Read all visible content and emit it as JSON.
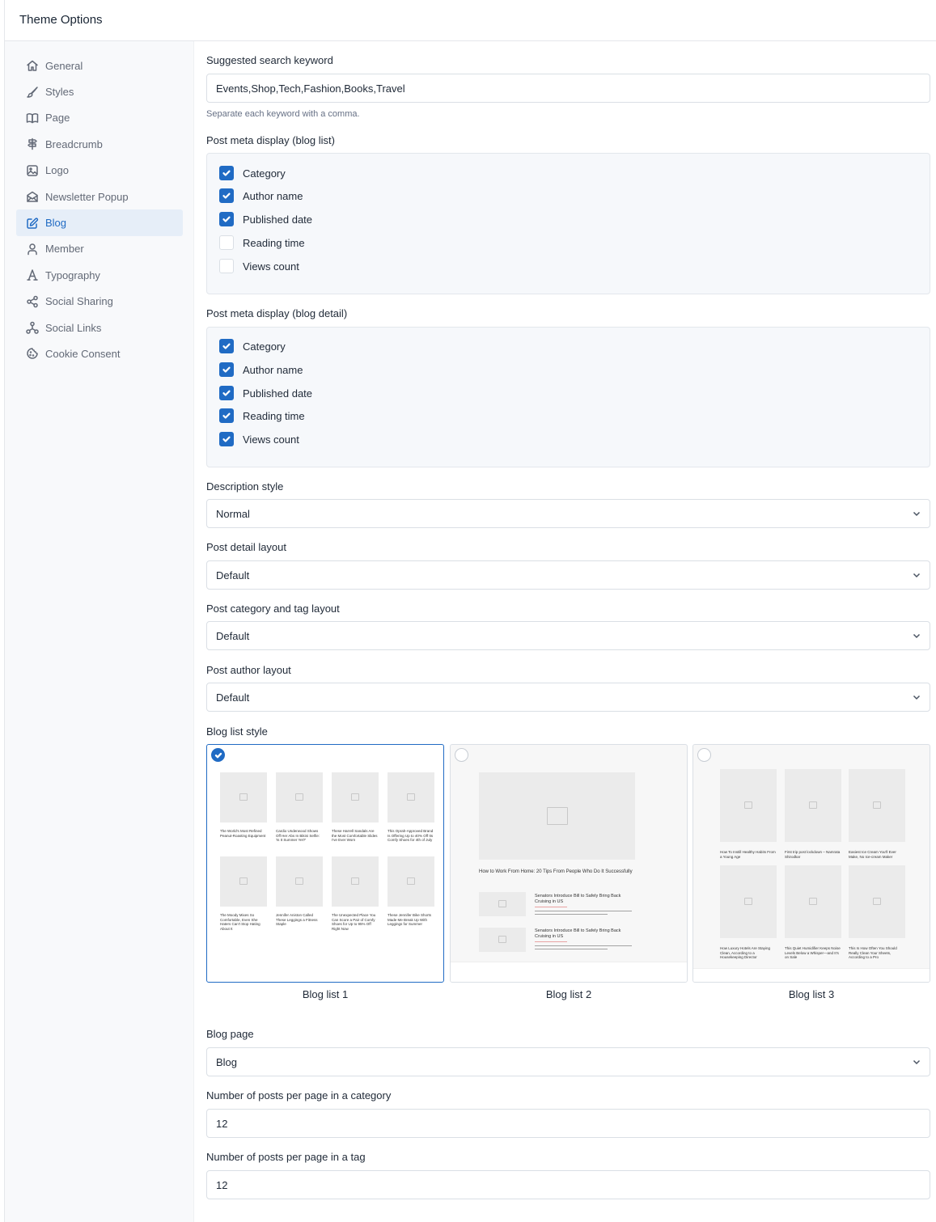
{
  "header": {
    "title": "Theme Options"
  },
  "sidebar": {
    "items": [
      {
        "label": "General",
        "icon": "home-icon"
      },
      {
        "label": "Styles",
        "icon": "brush-icon"
      },
      {
        "label": "Page",
        "icon": "book-icon"
      },
      {
        "label": "Breadcrumb",
        "icon": "signpost-icon"
      },
      {
        "label": "Logo",
        "icon": "image-icon"
      },
      {
        "label": "Newsletter Popup",
        "icon": "mail-open-icon"
      },
      {
        "label": "Blog",
        "icon": "edit-icon",
        "active": true
      },
      {
        "label": "Member",
        "icon": "user-icon"
      },
      {
        "label": "Typography",
        "icon": "typography-icon"
      },
      {
        "label": "Social Sharing",
        "icon": "share-icon"
      },
      {
        "label": "Social Links",
        "icon": "network-icon"
      },
      {
        "label": "Cookie Consent",
        "icon": "cookie-icon"
      }
    ]
  },
  "form": {
    "search_keyword": {
      "label": "Suggested search keyword",
      "value": "Events,Shop,Tech,Fashion,Books,Travel",
      "hint": "Separate each keyword with a comma."
    },
    "meta_list": {
      "label": "Post meta display (blog list)",
      "options": [
        {
          "label": "Category",
          "checked": true
        },
        {
          "label": "Author name",
          "checked": true
        },
        {
          "label": "Published date",
          "checked": true
        },
        {
          "label": "Reading time",
          "checked": false
        },
        {
          "label": "Views count",
          "checked": false
        }
      ]
    },
    "meta_detail": {
      "label": "Post meta display (blog detail)",
      "options": [
        {
          "label": "Category",
          "checked": true
        },
        {
          "label": "Author name",
          "checked": true
        },
        {
          "label": "Published date",
          "checked": true
        },
        {
          "label": "Reading time",
          "checked": true
        },
        {
          "label": "Views count",
          "checked": true
        }
      ]
    },
    "description_style": {
      "label": "Description style",
      "value": "Normal"
    },
    "post_detail_layout": {
      "label": "Post detail layout",
      "value": "Default"
    },
    "category_tag_layout": {
      "label": "Post category and tag layout",
      "value": "Default"
    },
    "author_layout": {
      "label": "Post author layout",
      "value": "Default"
    },
    "blog_list_style": {
      "label": "Blog list style",
      "options": [
        {
          "caption": "Blog list 1",
          "selected": true,
          "titles": [
            "The World's Most Refined Peanut-Roasting Equipment",
            "Cardio Underwood Shows Off Her Abs In Bikini Selfie: 'Is It Summer Yet?'",
            "These Harrell Sandals Are the Most Comfortable Slides I've Ever Worn",
            "This Oprah-Approved Brand Is Offering Up to 40% Off Its Comfy Shoes for 4th of July",
            "The Moody Mixes So Comfortable, Even She Haters Can't Stop Hating About It",
            "Jennifer Aniston Called These Leggings a Fitness Staple",
            "The Unexpected Place You Can Score a Pair of Comfy Shoes for Up to 95% Off Right Now",
            "These Jennifer Bike Shorts Made Me Break Up With Leggings for Summer"
          ]
        },
        {
          "caption": "Blog list 2",
          "selected": false,
          "titles": [
            "How to Work From Home: 20 Tips From People Who Do It Successfully",
            "Senators Introduce Bill to Safely Bring Back Cruising in US",
            "Senators Introduce Bill to Safely Bring Back Cruising in US"
          ]
        },
        {
          "caption": "Blog list 3",
          "selected": false,
          "titles": [
            "How To Instill Healthy Habits From a Young Age",
            "First trip post lockdown – Namrata Shirodkar",
            "Easiest Ice Cream You'll Ever Make, No Ice-cream Maker",
            "How Luxury Hotels Are Staying Clean, According to a Housekeeping Director",
            "This Quiet Humidifier Keeps Noise Levels Below a Whisper—and It's on Sale",
            "This Is How Often You Should Really Clean Your Sheets, According to a Pro"
          ]
        }
      ]
    },
    "blog_page": {
      "label": "Blog page",
      "value": "Blog"
    },
    "posts_per_category": {
      "label": "Number of posts per page in a category",
      "value": "12"
    },
    "posts_per_tag": {
      "label": "Number of posts per page in a tag",
      "value": "12"
    }
  },
  "colors": {
    "accent": "#206bc4",
    "sidebar_bg": "#f8f9fb",
    "panel_bg": "#f6f8fb"
  }
}
